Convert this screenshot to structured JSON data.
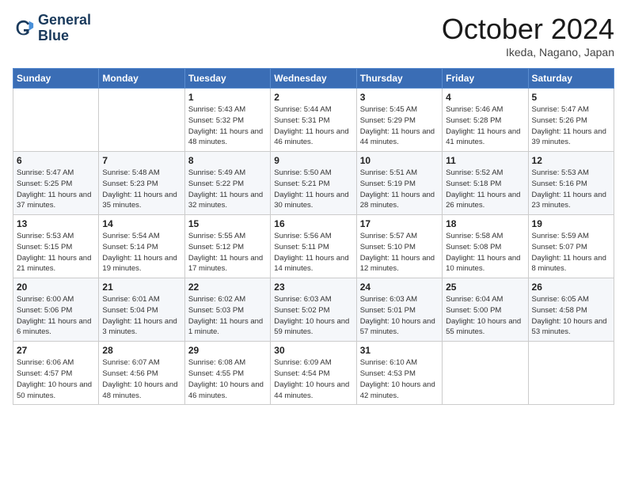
{
  "logo": {
    "line1": "General",
    "line2": "Blue"
  },
  "title": "October 2024",
  "location": "Ikeda, Nagano, Japan",
  "weekdays": [
    "Sunday",
    "Monday",
    "Tuesday",
    "Wednesday",
    "Thursday",
    "Friday",
    "Saturday"
  ],
  "weeks": [
    [
      {
        "day": "",
        "info": ""
      },
      {
        "day": "",
        "info": ""
      },
      {
        "day": "1",
        "info": "Sunrise: 5:43 AM\nSunset: 5:32 PM\nDaylight: 11 hours and 48 minutes."
      },
      {
        "day": "2",
        "info": "Sunrise: 5:44 AM\nSunset: 5:31 PM\nDaylight: 11 hours and 46 minutes."
      },
      {
        "day": "3",
        "info": "Sunrise: 5:45 AM\nSunset: 5:29 PM\nDaylight: 11 hours and 44 minutes."
      },
      {
        "day": "4",
        "info": "Sunrise: 5:46 AM\nSunset: 5:28 PM\nDaylight: 11 hours and 41 minutes."
      },
      {
        "day": "5",
        "info": "Sunrise: 5:47 AM\nSunset: 5:26 PM\nDaylight: 11 hours and 39 minutes."
      }
    ],
    [
      {
        "day": "6",
        "info": "Sunrise: 5:47 AM\nSunset: 5:25 PM\nDaylight: 11 hours and 37 minutes."
      },
      {
        "day": "7",
        "info": "Sunrise: 5:48 AM\nSunset: 5:23 PM\nDaylight: 11 hours and 35 minutes."
      },
      {
        "day": "8",
        "info": "Sunrise: 5:49 AM\nSunset: 5:22 PM\nDaylight: 11 hours and 32 minutes."
      },
      {
        "day": "9",
        "info": "Sunrise: 5:50 AM\nSunset: 5:21 PM\nDaylight: 11 hours and 30 minutes."
      },
      {
        "day": "10",
        "info": "Sunrise: 5:51 AM\nSunset: 5:19 PM\nDaylight: 11 hours and 28 minutes."
      },
      {
        "day": "11",
        "info": "Sunrise: 5:52 AM\nSunset: 5:18 PM\nDaylight: 11 hours and 26 minutes."
      },
      {
        "day": "12",
        "info": "Sunrise: 5:53 AM\nSunset: 5:16 PM\nDaylight: 11 hours and 23 minutes."
      }
    ],
    [
      {
        "day": "13",
        "info": "Sunrise: 5:53 AM\nSunset: 5:15 PM\nDaylight: 11 hours and 21 minutes."
      },
      {
        "day": "14",
        "info": "Sunrise: 5:54 AM\nSunset: 5:14 PM\nDaylight: 11 hours and 19 minutes."
      },
      {
        "day": "15",
        "info": "Sunrise: 5:55 AM\nSunset: 5:12 PM\nDaylight: 11 hours and 17 minutes."
      },
      {
        "day": "16",
        "info": "Sunrise: 5:56 AM\nSunset: 5:11 PM\nDaylight: 11 hours and 14 minutes."
      },
      {
        "day": "17",
        "info": "Sunrise: 5:57 AM\nSunset: 5:10 PM\nDaylight: 11 hours and 12 minutes."
      },
      {
        "day": "18",
        "info": "Sunrise: 5:58 AM\nSunset: 5:08 PM\nDaylight: 11 hours and 10 minutes."
      },
      {
        "day": "19",
        "info": "Sunrise: 5:59 AM\nSunset: 5:07 PM\nDaylight: 11 hours and 8 minutes."
      }
    ],
    [
      {
        "day": "20",
        "info": "Sunrise: 6:00 AM\nSunset: 5:06 PM\nDaylight: 11 hours and 6 minutes."
      },
      {
        "day": "21",
        "info": "Sunrise: 6:01 AM\nSunset: 5:04 PM\nDaylight: 11 hours and 3 minutes."
      },
      {
        "day": "22",
        "info": "Sunrise: 6:02 AM\nSunset: 5:03 PM\nDaylight: 11 hours and 1 minute."
      },
      {
        "day": "23",
        "info": "Sunrise: 6:03 AM\nSunset: 5:02 PM\nDaylight: 10 hours and 59 minutes."
      },
      {
        "day": "24",
        "info": "Sunrise: 6:03 AM\nSunset: 5:01 PM\nDaylight: 10 hours and 57 minutes."
      },
      {
        "day": "25",
        "info": "Sunrise: 6:04 AM\nSunset: 5:00 PM\nDaylight: 10 hours and 55 minutes."
      },
      {
        "day": "26",
        "info": "Sunrise: 6:05 AM\nSunset: 4:58 PM\nDaylight: 10 hours and 53 minutes."
      }
    ],
    [
      {
        "day": "27",
        "info": "Sunrise: 6:06 AM\nSunset: 4:57 PM\nDaylight: 10 hours and 50 minutes."
      },
      {
        "day": "28",
        "info": "Sunrise: 6:07 AM\nSunset: 4:56 PM\nDaylight: 10 hours and 48 minutes."
      },
      {
        "day": "29",
        "info": "Sunrise: 6:08 AM\nSunset: 4:55 PM\nDaylight: 10 hours and 46 minutes."
      },
      {
        "day": "30",
        "info": "Sunrise: 6:09 AM\nSunset: 4:54 PM\nDaylight: 10 hours and 44 minutes."
      },
      {
        "day": "31",
        "info": "Sunrise: 6:10 AM\nSunset: 4:53 PM\nDaylight: 10 hours and 42 minutes."
      },
      {
        "day": "",
        "info": ""
      },
      {
        "day": "",
        "info": ""
      }
    ]
  ]
}
